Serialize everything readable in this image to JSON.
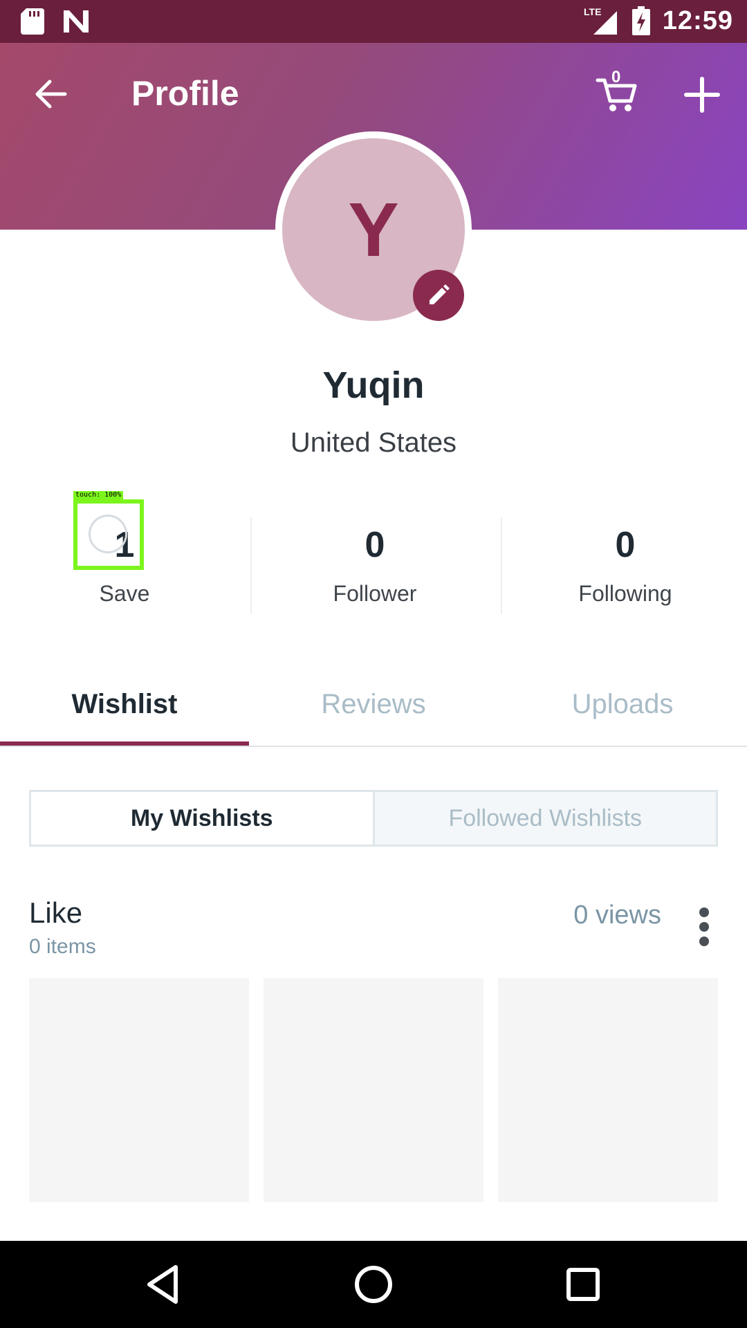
{
  "status_bar": {
    "time": "12:59",
    "network": "LTE",
    "icons": [
      "sd-card-icon",
      "n-notification-icon",
      "signal-icon",
      "battery-charging-icon"
    ]
  },
  "header": {
    "title": "Profile",
    "cart_count": "0",
    "back_icon": "arrow-left-icon",
    "cart_icon": "cart-icon",
    "add_icon": "plus-icon",
    "gradient_colors": [
      "#a4496a",
      "#8a44c0"
    ]
  },
  "profile": {
    "avatar_letter": "Y",
    "name": "Yuqin",
    "location": "United States",
    "edit_icon": "pencil-icon"
  },
  "stats": [
    {
      "value": "1",
      "label": "Save"
    },
    {
      "value": "0",
      "label": "Follower"
    },
    {
      "value": "0",
      "label": "Following"
    }
  ],
  "touch_overlay": {
    "label": "touch: 100%"
  },
  "tabs": [
    {
      "label": "Wishlist",
      "active": true
    },
    {
      "label": "Reviews",
      "active": false
    },
    {
      "label": "Uploads",
      "active": false
    }
  ],
  "segments": {
    "my": "My Wishlists",
    "followed": "Followed Wishlists"
  },
  "wishlist": {
    "title": "Like",
    "items": "0 items",
    "views": "0 views"
  },
  "colors": {
    "accent": "#8b2a4f",
    "status_bar": "#6a1f3d",
    "text_dark": "#1f2a33",
    "text_muted": "#a9bcc7",
    "touch_highlight": "#7cf51c"
  },
  "nav_bar": {
    "icons": [
      "back-triangle-icon",
      "home-circle-icon",
      "recents-square-icon"
    ]
  }
}
